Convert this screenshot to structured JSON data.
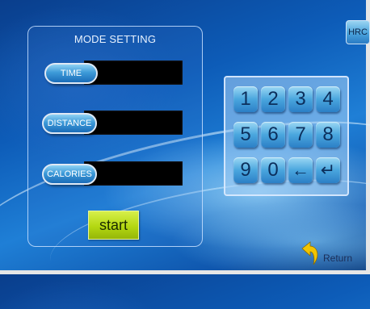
{
  "mode_panel": {
    "title": "MODE SETTING",
    "time_label": "TIME",
    "time_value": "",
    "distance_label": "DISTANCE",
    "distance_value": "",
    "calories_label": "CALORIES",
    "calories_value": "",
    "start_label": "start"
  },
  "keypad": {
    "keys": [
      "1",
      "2",
      "3",
      "4",
      "5",
      "6",
      "7",
      "8",
      "9",
      "0",
      "←",
      "↵"
    ]
  },
  "hrc_button": {
    "label": "HRC"
  },
  "return_button": {
    "label": "Return",
    "icon": "return-arrow-icon"
  },
  "colors": {
    "start_button": "#b4d812",
    "key": "#4aa6de",
    "background": "#0d5cb8"
  }
}
